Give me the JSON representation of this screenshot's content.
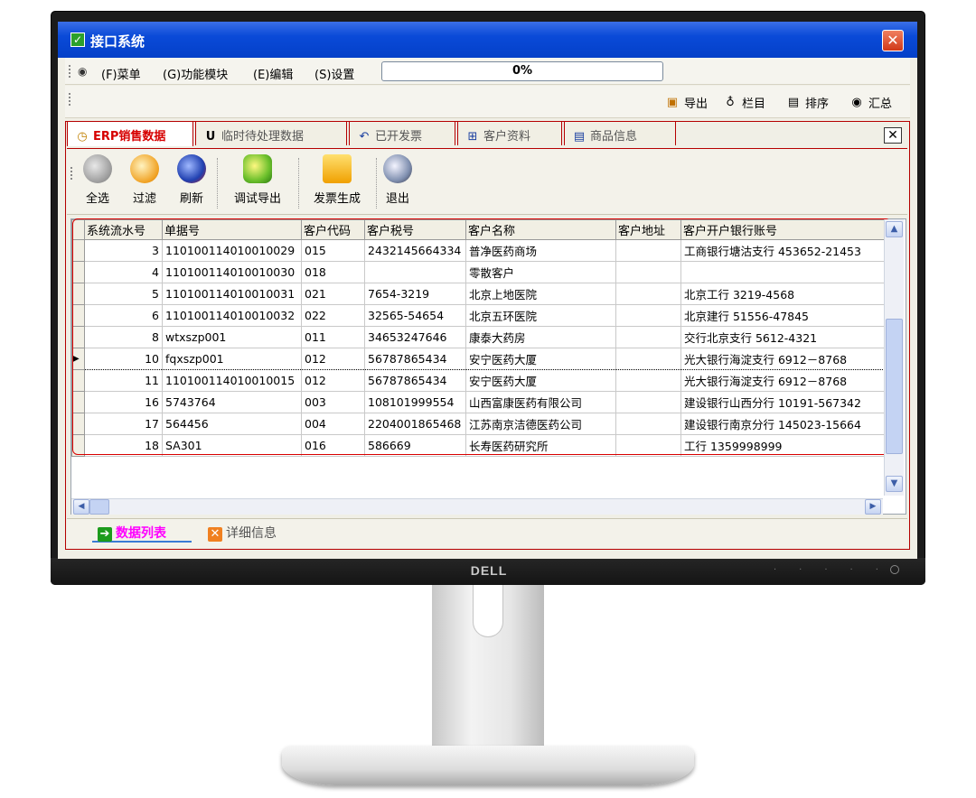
{
  "monitor": {
    "brand": "DELL"
  },
  "window": {
    "title": "接口系统",
    "close_symbol": "✕"
  },
  "menu": {
    "items": [
      "(F)菜单",
      "(G)功能模块",
      "(E)编辑",
      "(S)设置"
    ],
    "progress": "0%"
  },
  "toolbar2": {
    "items": [
      "导出",
      "栏目",
      "排序",
      "汇总"
    ]
  },
  "tabs": {
    "items": [
      "ERP销售数据",
      "临时待处理数据",
      "已开发票",
      "客户资料",
      "商品信息"
    ],
    "active": 0,
    "close_symbol": "✕"
  },
  "ribbon": {
    "buttons": [
      "全选",
      "过滤",
      "刷新",
      "调试导出",
      "发票生成",
      "退出"
    ]
  },
  "grid": {
    "columns": [
      "系统流水号",
      "单据号",
      "客户代码",
      "客户税号",
      "客户名称",
      "客户地址",
      "客户开户银行账号"
    ],
    "rows": [
      [
        "3",
        "110100114010010029",
        "015",
        "2432145664334",
        "普净医药商场",
        "",
        "工商银行塘沽支行 453652-21453"
      ],
      [
        "4",
        "110100114010010030",
        "018",
        "",
        "零散客户",
        "",
        ""
      ],
      [
        "5",
        "110100114010010031",
        "021",
        "7654-3219",
        "北京上地医院",
        "",
        "北京工行 3219-4568"
      ],
      [
        "6",
        "110100114010010032",
        "022",
        "32565-54654",
        "北京五环医院",
        "",
        "北京建行 51556-47845"
      ],
      [
        "8",
        "wtxszp001",
        "011",
        "34653247646",
        "康泰大药房",
        "",
        "交行北京支行 5612-4321"
      ],
      [
        "10",
        "fqxszp001",
        "012",
        "56787865434",
        "安宁医药大厦",
        "",
        "光大银行海淀支行 6912－8768"
      ],
      [
        "11",
        "110100114010010015",
        "012",
        "56787865434",
        "安宁医药大厦",
        "",
        "光大银行海淀支行 6912－8768"
      ],
      [
        "16",
        "5743764",
        "003",
        "108101999554",
        "山西富康医药有限公司",
        "",
        "建设银行山西分行 10191-567342"
      ],
      [
        "17",
        "564456",
        "004",
        "2204001865468",
        "江苏南京洁德医药公司",
        "",
        "建设银行南京分行 145023-15664"
      ],
      [
        "18",
        "SA301",
        "016",
        "586669",
        "长寿医药研究所",
        "",
        "工行 1359998999"
      ]
    ],
    "selected_row": 5
  },
  "bottom_tabs": {
    "items": [
      "数据列表",
      "详细信息"
    ],
    "active": 0
  }
}
